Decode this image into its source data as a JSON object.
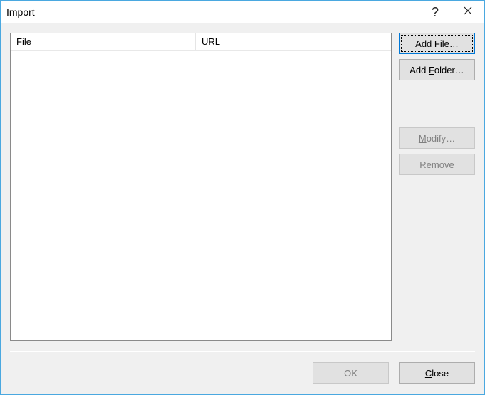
{
  "titlebar": {
    "title": "Import",
    "help_symbol": "?"
  },
  "table": {
    "headers": {
      "file": "File",
      "url": "URL"
    },
    "rows": []
  },
  "buttons": {
    "add_file_prefix": "A",
    "add_file_rest": "dd File…",
    "add_folder_prefix": "Add ",
    "add_folder_underline": "F",
    "add_folder_rest": "older…",
    "modify_prefix": "",
    "modify_underline": "M",
    "modify_rest": "odify…",
    "remove_prefix": "",
    "remove_underline": "R",
    "remove_rest": "emove",
    "ok": "OK",
    "close_underline": "C",
    "close_rest": "lose"
  }
}
